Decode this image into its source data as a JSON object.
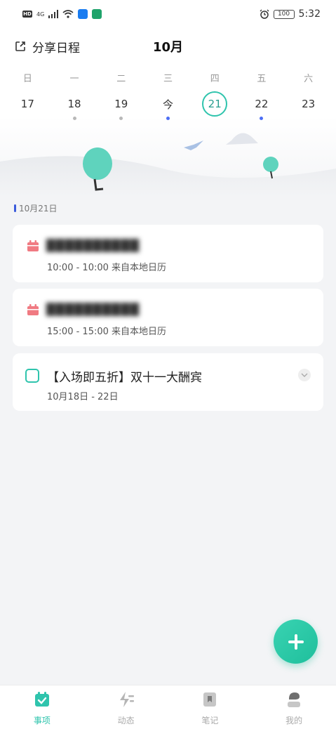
{
  "status_bar": {
    "time": "5:32",
    "battery": "100",
    "network": "4G"
  },
  "header": {
    "share_label": "分享日程",
    "month": "10月"
  },
  "week": [
    {
      "name": "日",
      "num": "17",
      "dot": "none"
    },
    {
      "name": "一",
      "num": "18",
      "dot": "gray"
    },
    {
      "name": "二",
      "num": "19",
      "dot": "gray"
    },
    {
      "name": "三",
      "num": "今",
      "dot": "blue"
    },
    {
      "name": "四",
      "num": "21",
      "dot": "none",
      "selected": true
    },
    {
      "name": "五",
      "num": "22",
      "dot": "blue"
    },
    {
      "name": "六",
      "num": "23",
      "dot": "none"
    }
  ],
  "date_label": "10月21日",
  "events": [
    {
      "title": "██████████",
      "subtitle": "10:00 - 10:00 来自本地日历"
    },
    {
      "title": "██████████",
      "subtitle": "15:00 - 15:00 来自本地日历"
    }
  ],
  "task": {
    "title": "【入场即五折】双十一大酬宾",
    "subtitle": "10月18日 - 22日"
  },
  "bottom_nav": [
    {
      "label": "事项",
      "active": true,
      "icon": "calendar-check-icon"
    },
    {
      "label": "动态",
      "active": false,
      "icon": "activity-icon"
    },
    {
      "label": "笔记",
      "active": false,
      "icon": "bookmark-icon"
    },
    {
      "label": "我的",
      "active": false,
      "icon": "person-icon"
    }
  ],
  "colors": {
    "accent": "#2fc4ad",
    "event_icon": "#f07a82",
    "today_dot": "#4c6ef5"
  }
}
